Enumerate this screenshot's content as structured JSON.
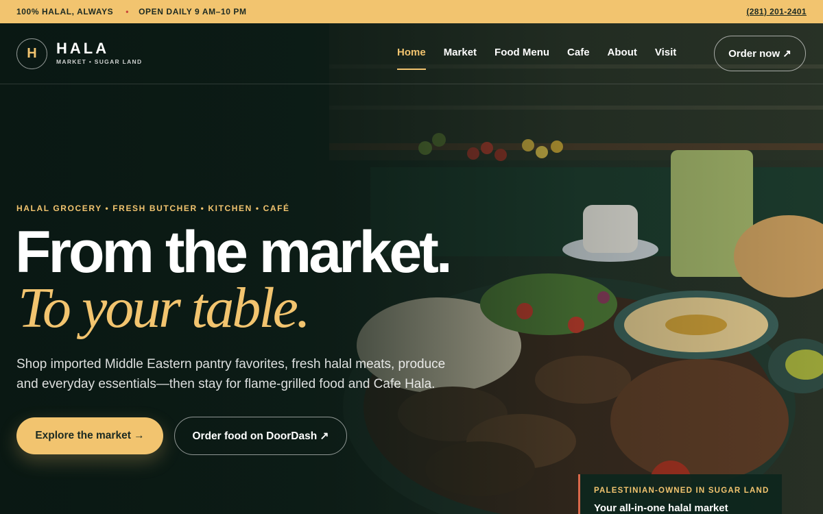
{
  "topbar": {
    "halal_note": "100% HALAL, ALWAYS",
    "hours": "OPEN DAILY 9 AM–10 PM",
    "phone": "(281) 201-2401"
  },
  "brand": {
    "initial": "H",
    "name": "HALA",
    "subtitle": "MARKET • SUGAR LAND"
  },
  "nav": {
    "items": [
      {
        "label": "Home",
        "active": true
      },
      {
        "label": "Market"
      },
      {
        "label": "Food Menu"
      },
      {
        "label": "Cafe"
      },
      {
        "label": "About"
      },
      {
        "label": "Visit"
      }
    ],
    "order_label": "Order now ↗"
  },
  "hero": {
    "eyebrow": "HALAL GROCERY • FRESH BUTCHER • KITCHEN • CAFÉ",
    "headline": "From the market.",
    "headline_accent": "To your table.",
    "lead": "Shop imported Middle Eastern pantry favorites, fresh halal meats, produce and everyday essentials—then stay for flame-grilled food and Cafe Hala.",
    "primary_cta": "Explore the market →",
    "secondary_cta": "Order food on DoorDash ↗"
  },
  "card": {
    "tag": "PALESTINIAN-OWNED IN SUGAR LAND",
    "title": "Your all-in-one halal market"
  },
  "colors": {
    "accent": "#f2c46f",
    "dark_green": "#0f1f19",
    "card_border": "#d9684a"
  }
}
